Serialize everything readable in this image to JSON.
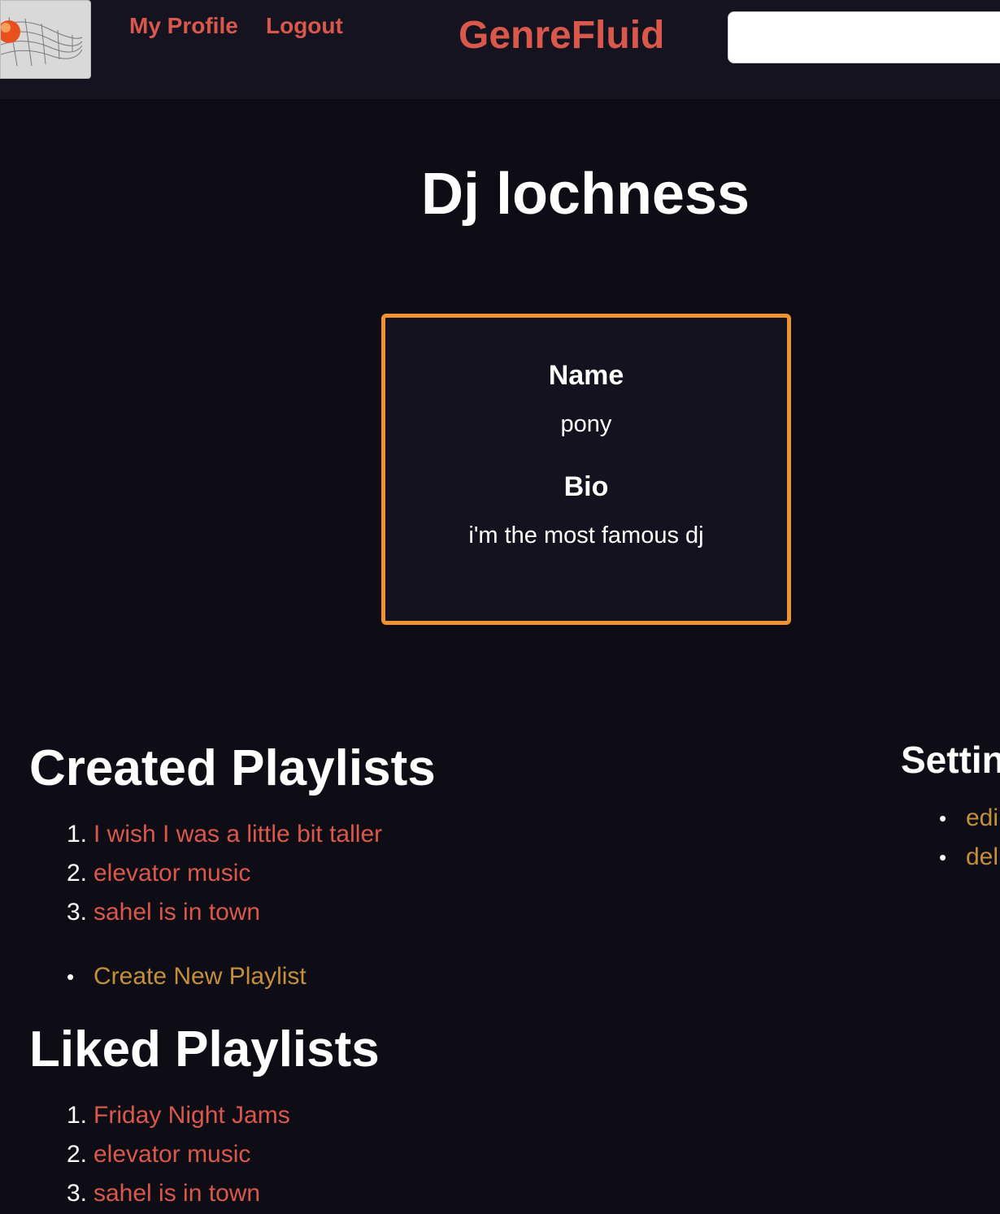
{
  "nav": {
    "links": [
      "My Profile",
      "Logout"
    ],
    "brand": "GenreFluid",
    "search_value": "",
    "logo_icon": "wave-globe-logo-icon"
  },
  "page_title": "Dj lochness",
  "profile": {
    "name_label": "Name",
    "name_value": "pony",
    "bio_label": "Bio",
    "bio_value": "i'm the most famous dj"
  },
  "created": {
    "heading": "Created Playlists",
    "items": [
      "I wish I was a little bit taller",
      "elevator music",
      "sahel is in town"
    ],
    "create_link": "Create New Playlist"
  },
  "liked": {
    "heading": "Liked Playlists",
    "items": [
      "Friday Night Jams",
      "elevator music",
      "sahel is in town"
    ]
  },
  "settings": {
    "heading": "Settin",
    "items": [
      "edi",
      "del"
    ]
  },
  "colors": {
    "background": "#0e0d16",
    "navbar": "#15131f",
    "link_red": "#d9584b",
    "link_gold": "#c48f3d",
    "card_border": "#f0932e"
  }
}
